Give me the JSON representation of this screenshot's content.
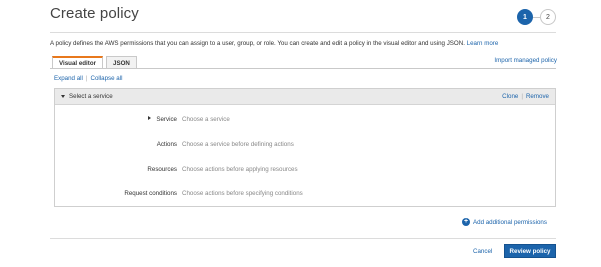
{
  "page": {
    "title": "Create policy",
    "steps": [
      "1",
      "2"
    ],
    "intro_text": "A policy defines the AWS permissions that you can assign to a user, group, or role. You can create and edit a policy in the visual editor and using JSON.",
    "learn_more": "Learn more"
  },
  "tabs": [
    {
      "label": "Visual editor",
      "active": true
    },
    {
      "label": "JSON",
      "active": false
    }
  ],
  "import_link": "Import managed policy",
  "expand_all": "Expand all",
  "separator": "|",
  "collapse_all": "Collapse all",
  "panel": {
    "header": "Select a service",
    "clone": "Clone",
    "remove": "Remove",
    "fields": [
      {
        "label": "Service",
        "value": "Choose a service"
      },
      {
        "label": "Actions",
        "value": "Choose a service before defining actions"
      },
      {
        "label": "Resources",
        "value": "Choose actions before applying resources"
      },
      {
        "label": "Request conditions",
        "value": "Choose actions before specifying conditions"
      }
    ]
  },
  "add_permissions": "Add additional permissions",
  "footer": {
    "cancel": "Cancel",
    "review": "Review policy"
  },
  "colors": {
    "accent": "#1c64ab",
    "tab_highlight": "#e8781c"
  }
}
